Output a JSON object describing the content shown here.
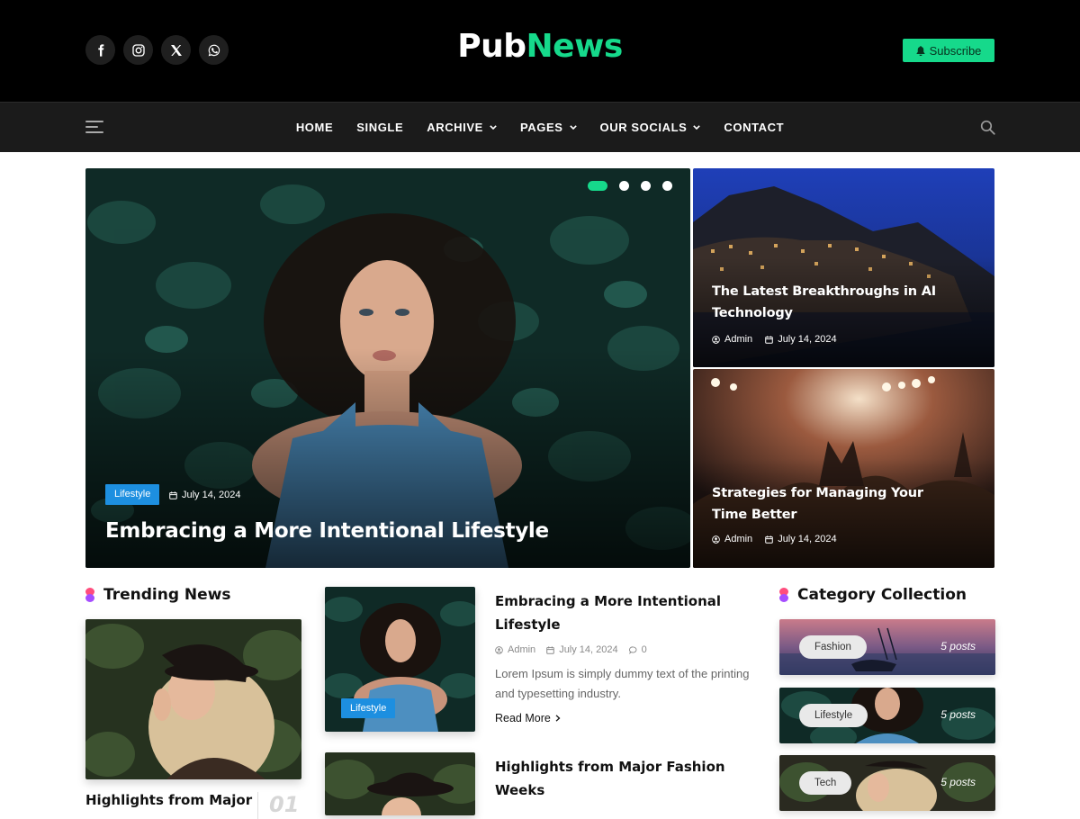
{
  "header": {
    "logo_part1": "Pub",
    "logo_part2": "News",
    "subscribe_label": "Subscribe",
    "socials": [
      "facebook-icon",
      "instagram-icon",
      "x-icon",
      "whatsapp-icon"
    ]
  },
  "nav": {
    "items": [
      {
        "label": "HOME",
        "dropdown": false
      },
      {
        "label": "SINGLE",
        "dropdown": false
      },
      {
        "label": "ARCHIVE",
        "dropdown": true
      },
      {
        "label": "PAGES",
        "dropdown": true
      },
      {
        "label": "OUR SOCIALS",
        "dropdown": true
      },
      {
        "label": "CONTACT",
        "dropdown": false
      }
    ]
  },
  "hero": {
    "main": {
      "category": "Lifestyle",
      "date": "July 14, 2024",
      "title": "Embracing a More Intentional Lifestyle"
    },
    "side": [
      {
        "title": "The Latest Breakthroughs in AI Technology",
        "author": "Admin",
        "date": "July 14, 2024"
      },
      {
        "title": "Strategies for Managing Your Time Better",
        "author": "Admin",
        "date": "July 14, 2024"
      }
    ]
  },
  "trending": {
    "heading": "Trending News",
    "item_title": "Highlights from Major",
    "item_number": "01"
  },
  "articles": [
    {
      "title": "Embracing a More Intentional Lifestyle",
      "category": "Lifestyle",
      "author": "Admin",
      "date": "July 14, 2024",
      "comments": "0",
      "excerpt": "Lorem Ipsum is simply dummy text of the printing and typesetting industry.",
      "read_more": "Read More"
    },
    {
      "title": "Highlights from Major Fashion Weeks"
    }
  ],
  "categories": {
    "heading": "Category Collection",
    "items": [
      {
        "name": "Fashion",
        "count": "5 posts"
      },
      {
        "name": "Lifestyle",
        "count": "5 posts"
      },
      {
        "name": "Tech",
        "count": "5 posts"
      }
    ]
  },
  "colors": {
    "accent": "#16d98b",
    "badge": "#1d8fe0",
    "header_bg": "#000000",
    "nav_bg": "#1b1b1b"
  }
}
